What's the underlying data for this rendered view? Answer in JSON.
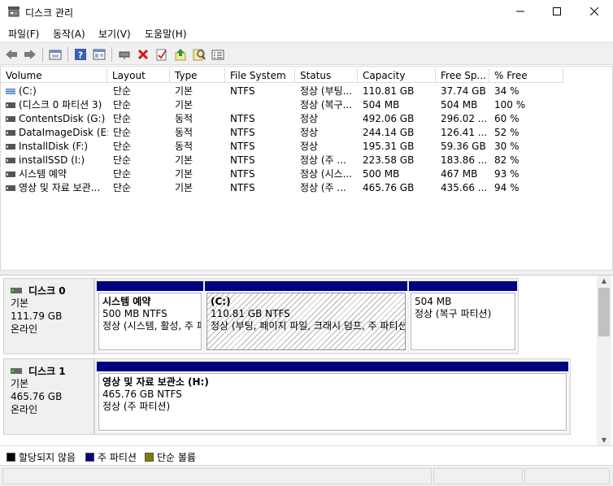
{
  "window": {
    "title": "디스크 관리",
    "min_glyph": "—",
    "max_glyph": "☐",
    "close_glyph": "✕"
  },
  "menu": [
    "파일(F)",
    "동작(A)",
    "보기(V)",
    "도움말(H)"
  ],
  "toolbar": {
    "icons": [
      "back-icon",
      "forward-icon",
      "up-level-icon",
      "help-icon",
      "properties-icon",
      "connect-drive-icon",
      "delete-icon",
      "check-icon",
      "rescan-icon",
      "find-icon",
      "settings-icon"
    ]
  },
  "volume_list": {
    "columns": [
      "Volume",
      "Layout",
      "Type",
      "File System",
      "Status",
      "Capacity",
      "Free Sp...",
      "% Free"
    ],
    "rows": [
      {
        "volume": "(C:)",
        "layout": "단순",
        "type": "기본",
        "fs": "NTFS",
        "status": "정상 (부팅...",
        "capacity": "110.81 GB",
        "free": "37.74 GB",
        "pct": "34 %",
        "icon": "striped-volume-icon"
      },
      {
        "volume": "(디스크 0 파티션 3)",
        "layout": "단순",
        "type": "기본",
        "fs": "",
        "status": "정상 (복구...",
        "capacity": "504 MB",
        "free": "504 MB",
        "pct": "100 %",
        "icon": "volume-icon"
      },
      {
        "volume": "ContentsDisk (G:)",
        "layout": "단순",
        "type": "동적",
        "fs": "NTFS",
        "status": "정상",
        "capacity": "492.06 GB",
        "free": "296.02 ...",
        "pct": "60 %",
        "icon": "volume-icon"
      },
      {
        "volume": "DataImageDisk (E:)",
        "layout": "단순",
        "type": "동적",
        "fs": "NTFS",
        "status": "정상",
        "capacity": "244.14 GB",
        "free": "126.41 ...",
        "pct": "52 %",
        "icon": "volume-icon"
      },
      {
        "volume": "InstallDisk (F:)",
        "layout": "단순",
        "type": "동적",
        "fs": "NTFS",
        "status": "정상",
        "capacity": "195.31 GB",
        "free": "59.36 GB",
        "pct": "30 %",
        "icon": "volume-icon"
      },
      {
        "volume": "installSSD (I:)",
        "layout": "단순",
        "type": "기본",
        "fs": "NTFS",
        "status": "정상 (주 ...",
        "capacity": "223.58 GB",
        "free": "183.86 ...",
        "pct": "82 %",
        "icon": "volume-icon"
      },
      {
        "volume": "시스템 예약",
        "layout": "단순",
        "type": "기본",
        "fs": "NTFS",
        "status": "정상 (시스...",
        "capacity": "500 MB",
        "free": "467 MB",
        "pct": "93 %",
        "icon": "volume-icon"
      },
      {
        "volume": "영상 및 자료 보관...",
        "layout": "단순",
        "type": "기본",
        "fs": "NTFS",
        "status": "정상 (주 ...",
        "capacity": "465.76 GB",
        "free": "435.66 ...",
        "pct": "94 %",
        "icon": "volume-icon"
      }
    ]
  },
  "disks": [
    {
      "name": "디스크 0",
      "type": "기본",
      "size": "111.79 GB",
      "state": "온라인",
      "partitions": [
        {
          "name": "시스템 예약",
          "size_fs": "500 MB NTFS",
          "status": "정상 (시스템, 활성, 주 파티션)"
        },
        {
          "name": "(C:)",
          "size_fs": "110.81 GB NTFS",
          "status": "정상 (부팅, 페이지 파일, 크래시 덤프, 주 파티션)"
        },
        {
          "name": "",
          "size_fs": "504 MB",
          "status": "정상 (복구 파티션)"
        }
      ]
    },
    {
      "name": "디스크 1",
      "type": "기본",
      "size": "465.76 GB",
      "state": "온라인",
      "partitions": [
        {
          "name": "영상 및 자료 보관소  (H:)",
          "size_fs": "465.76 GB NTFS",
          "status": "정상 (주 파티션)"
        }
      ]
    }
  ],
  "legend": [
    {
      "label": "할당되지 않음",
      "color": "#000000"
    },
    {
      "label": "주 파티션",
      "color": "#000080"
    },
    {
      "label": "단순 볼륨",
      "color": "#808000"
    }
  ],
  "colors": {
    "partition_header": "#000080"
  }
}
